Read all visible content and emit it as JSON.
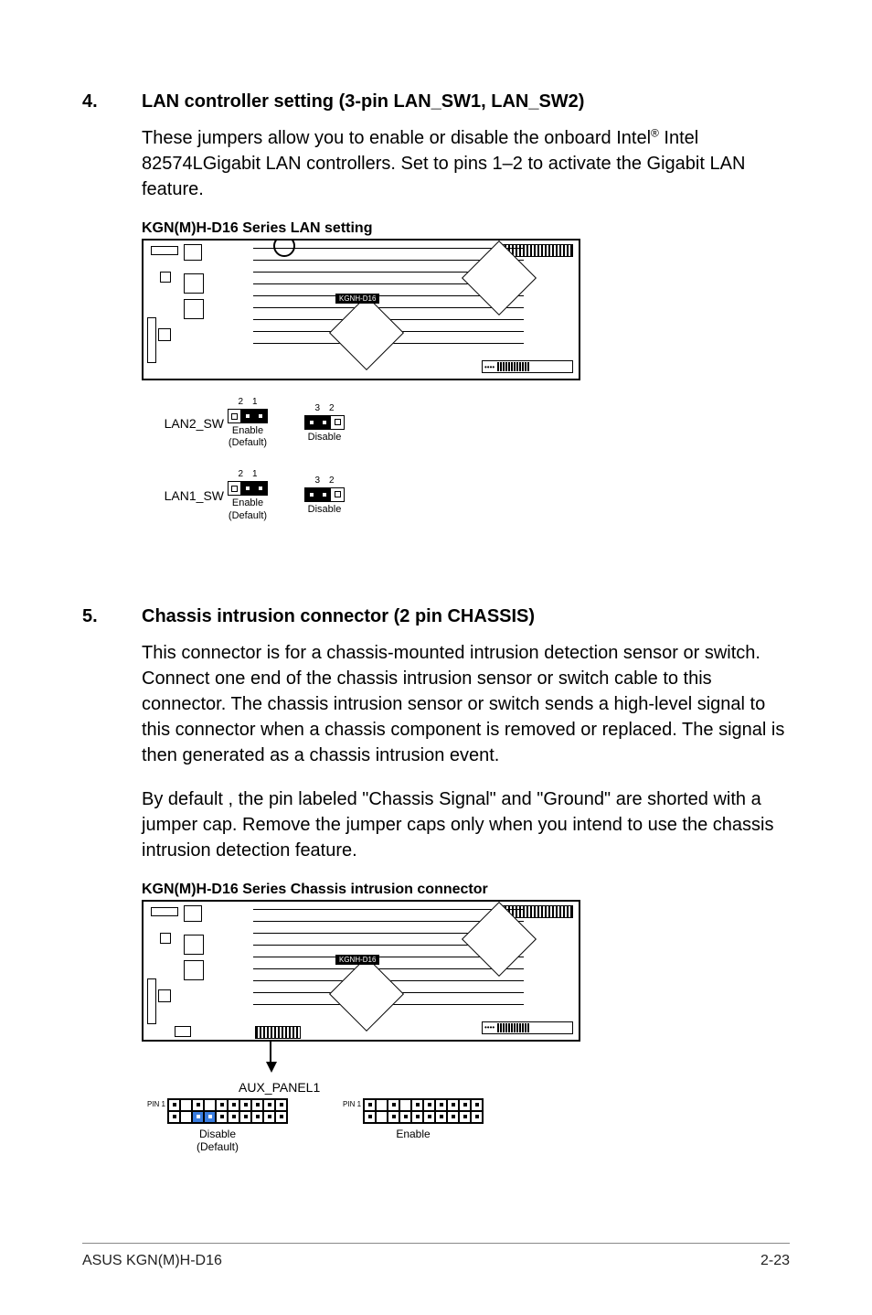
{
  "sections": [
    {
      "num": "4.",
      "title": "LAN controller setting (3-pin LAN_SW1, LAN_SW2)",
      "text_before_sup": "These jumpers allow you to enable or disable the onboard Intel",
      "sup": "®",
      "text_after_sup": " Intel 82574LGigabit LAN controllers. Set to pins 1–2 to activate the Gigabit LAN feature.",
      "diagram_title": "KGN(M)H-D16 Series LAN setting",
      "mobo_label": "KGNH-D16",
      "jumpers": [
        {
          "label": "LAN2_SW",
          "units": [
            {
              "pin_nums": [
                "2",
                "1"
              ],
              "pattern": [
                "open",
                "filled",
                "filled"
              ],
              "sub1": "Enable",
              "sub2": "(Default)"
            },
            {
              "pin_nums": [
                "3",
                "2"
              ],
              "pattern": [
                "filled",
                "filled",
                "open"
              ],
              "sub1": "Disable",
              "sub2": ""
            }
          ]
        },
        {
          "label": "LAN1_SW",
          "units": [
            {
              "pin_nums": [
                "2",
                "1"
              ],
              "pattern": [
                "open",
                "filled",
                "filled"
              ],
              "sub1": "Enable",
              "sub2": "(Default)"
            },
            {
              "pin_nums": [
                "3",
                "2"
              ],
              "pattern": [
                "filled",
                "filled",
                "open"
              ],
              "sub1": "Disable",
              "sub2": ""
            }
          ]
        }
      ]
    },
    {
      "num": "5.",
      "title": "Chassis intrusion connector (2 pin CHASSIS)",
      "paragraphs": [
        "This connector is for a chassis-mounted intrusion detection sensor or switch. Connect one end of the chassis intrusion sensor or switch cable to this connector. The chassis intrusion sensor or switch sends a high-level signal to this connector when a chassis component is removed or replaced. The signal is then generated as a chassis intrusion event.",
        "By default , the pin labeled \"Chassis Signal\" and \"Ground\" are shorted with a jumper cap. Remove the jumper caps only when you intend to use the chassis intrusion detection feature."
      ],
      "diagram_title": "KGN(M)H-D16 Series Chassis intrusion connector",
      "mobo_label": "KGNH-D16",
      "aux_label": "AUX_PANEL1",
      "pin1_label": "PIN 1",
      "panels": [
        {
          "highlight": true,
          "sub1": "Disable",
          "sub2": "(Default)"
        },
        {
          "highlight": false,
          "sub1": "Enable",
          "sub2": ""
        }
      ]
    }
  ],
  "footer": {
    "left": "ASUS KGN(M)H-D16",
    "right": "2-23"
  }
}
